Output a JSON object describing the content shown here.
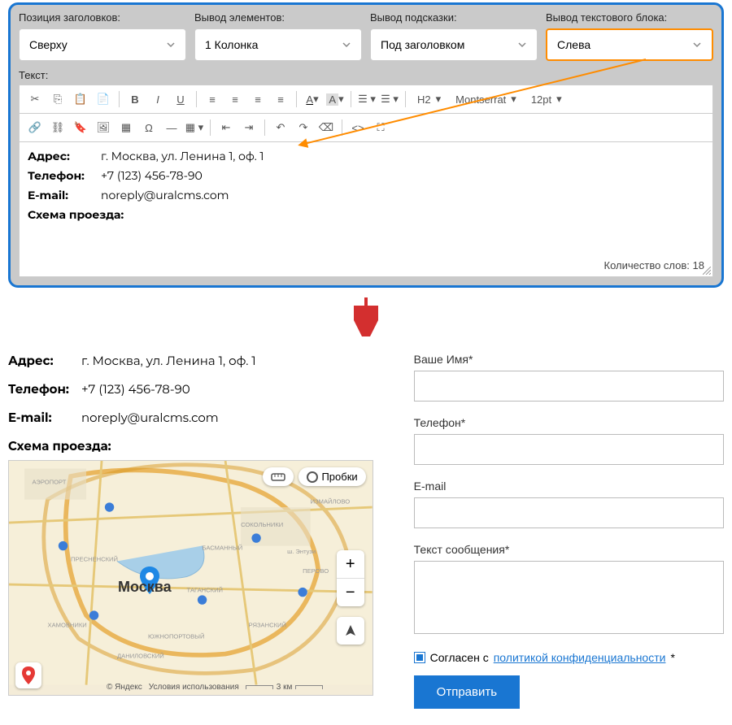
{
  "admin": {
    "fields": {
      "heading_position": {
        "label": "Позиция заголовков:",
        "value": "Сверху"
      },
      "elements_output": {
        "label": "Вывод элементов:",
        "value": "1 Колонка"
      },
      "hint_output": {
        "label": "Вывод подсказки:",
        "value": "Под заголовком"
      },
      "text_block_output": {
        "label": "Вывод текстового блока:",
        "value": "Слева"
      }
    },
    "text_label": "Текст:",
    "toolbar": {
      "heading_select": "H2",
      "font_select": "Montserrat",
      "size_select": "12pt"
    },
    "content": {
      "address_label": "Адрес:",
      "address_value": "г. Москва, ул. Ленина 1, оф. 1",
      "phone_label": "Телефон:",
      "phone_value": "+7 (123) 456-78-90",
      "email_label": "E-mail:",
      "email_value": "noreply@uralcms.com",
      "schema_label": "Схема проезда:"
    },
    "word_count_label": "Количество слов:",
    "word_count_value": "18"
  },
  "preview": {
    "info": {
      "address_label": "Адрес:",
      "address_value": "г. Москва, ул. Ленина 1, оф. 1",
      "phone_label": "Телефон:",
      "phone_value": "+7 (123) 456-78-90",
      "email_label": "E-mail:",
      "email_value": "noreply@uralcms.com",
      "schema_label": "Схема проезда:"
    },
    "map": {
      "city": "Москва",
      "traffic_btn": "Пробки",
      "attribution_prefix": "© Яндекс",
      "terms": "Условия использования",
      "scale": "3 км"
    },
    "form": {
      "name_label": "Ваше Имя*",
      "phone_label": "Телефон*",
      "email_label": "E-mail",
      "message_label": "Текст сообщения*",
      "consent_prefix": "Согласен с ",
      "consent_link": "политикой конфиденциальности",
      "consent_suffix": "*",
      "submit": "Отправить"
    }
  }
}
